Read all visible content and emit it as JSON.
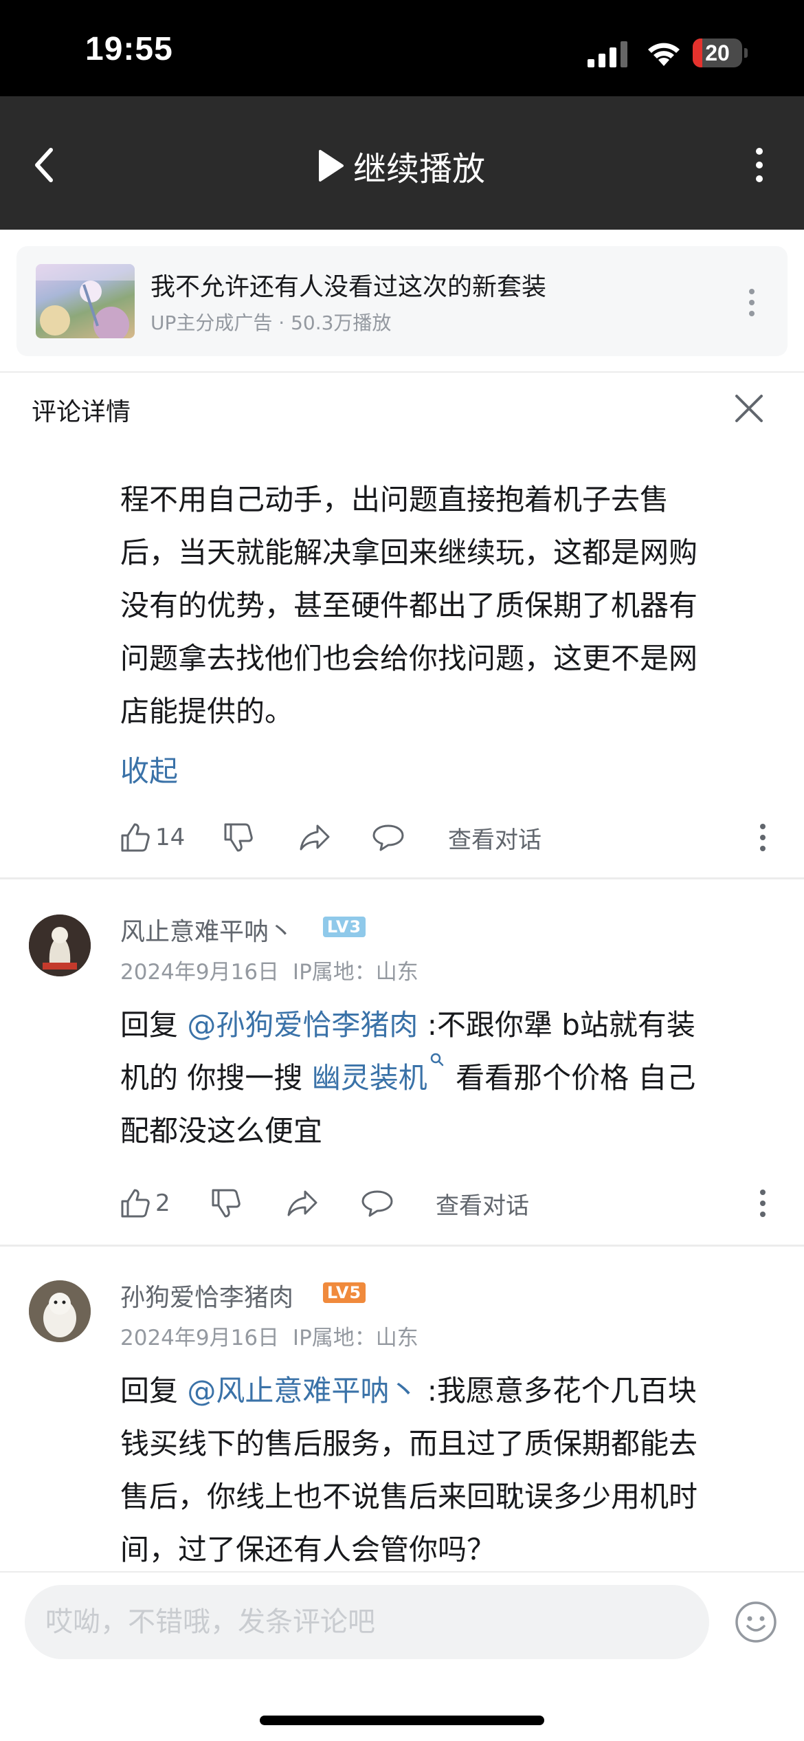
{
  "status_bar": {
    "time": "19:55",
    "battery": "20",
    "battery_level": 0.2
  },
  "header": {
    "title": "继续播放",
    "icons": [
      "back-icon",
      "play-icon",
      "more-icon"
    ]
  },
  "ad": {
    "title": "我不允许还有人没看过这次的新套装",
    "subtitle": "UP主分成广告 · 50.3万播放"
  },
  "panel": {
    "title": "评论详情"
  },
  "comments": [
    {
      "text_lines": [
        "程不用自己动手，出问题直接抱着机子去售",
        "后，当天就能解决拿回来继续玩，这都是网购",
        "没有的优势，甚至硬件都出了质保期了机器有",
        "问题拿去找他们也会给你找问题，这更不是网",
        "店能提供的。"
      ],
      "collapse_label": "收起",
      "likes": "14",
      "view_dialog": "查看对话"
    },
    {
      "username": "风止意难平呐丶",
      "level": "LV3",
      "level_color": "#8fc9ea",
      "date": "2024年9月16日",
      "ip": "IP属地：山东",
      "reply_prefix": "回复 ",
      "mention": "@孙狗爱恰李猪肉",
      "line1_rest": " :不跟你犟  b站就有装",
      "line2_start": "机的 你搜一搜 ",
      "search_link": "幽灵装机",
      "line2_rest": " 看看那个价格 自己",
      "line3": "配都没这么便宜",
      "likes": "2",
      "view_dialog": "查看对话"
    },
    {
      "username": "孙狗爱恰李猪肉",
      "level": "LV5",
      "level_color": "#f08a3c",
      "date": "2024年9月16日",
      "ip": "IP属地：山东",
      "reply_prefix": "回复 ",
      "mention": "@风止意难平呐丶",
      "line1_rest": " :我愿意多花个几百块",
      "line2": "钱买线下的售后服务，而且过了质保期都能去",
      "line3": "售后，你线上也不说售后来回耽误多少用机时",
      "line4": "间，过了保还有人会管你吗？"
    }
  ],
  "input": {
    "placeholder": "哎呦，不错哦，发条评论吧"
  }
}
